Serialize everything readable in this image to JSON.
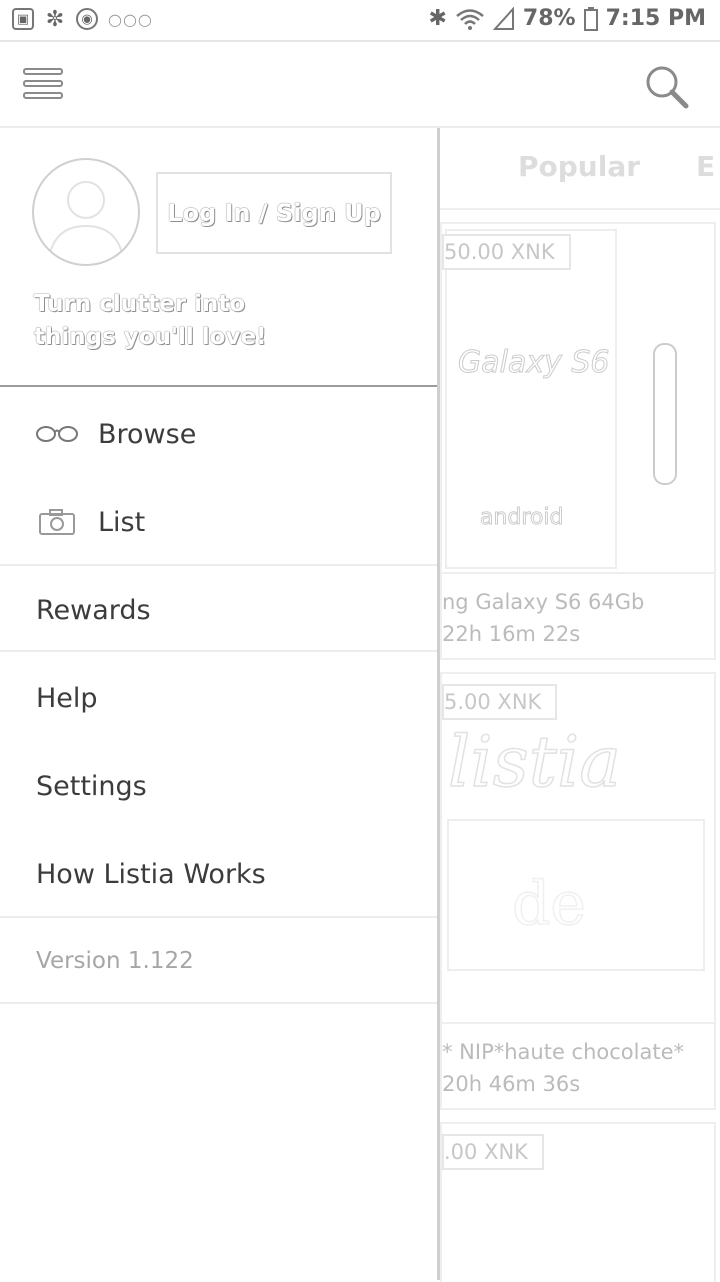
{
  "status_bar": {
    "battery": "78%",
    "time": "7:15 PM",
    "icons": [
      "gallery-icon",
      "pinwheel-icon",
      "target-icon",
      "more-dots-icon",
      "bluetooth-icon",
      "wifi-icon",
      "signal-icon",
      "battery-icon"
    ]
  },
  "app_bar": {
    "menu_icon": "hamburger-menu-icon",
    "search_icon": "search-icon"
  },
  "background": {
    "tabs": [
      "Popular",
      "E"
    ],
    "cards": [
      {
        "price": "50.00 XNK",
        "title": "ng Galaxy S6 64Gb",
        "time": "22h 16m 22s"
      },
      {
        "price": "5.00 XNK",
        "title": "* NIP*haute chocolate*",
        "time": "20h 46m 36s"
      },
      {
        "price": ".00 XNK"
      }
    ]
  },
  "drawer": {
    "login_label": "Log In / Sign Up",
    "tagline": "Turn clutter into things you'll love!",
    "items": [
      {
        "label": "Browse",
        "icon": "glasses-icon"
      },
      {
        "label": "List",
        "icon": "camera-icon"
      },
      {
        "label": "Rewards"
      },
      {
        "label": "Help"
      },
      {
        "label": "Settings"
      },
      {
        "label": "How Listia Works"
      }
    ],
    "version": "Version 1.122"
  }
}
